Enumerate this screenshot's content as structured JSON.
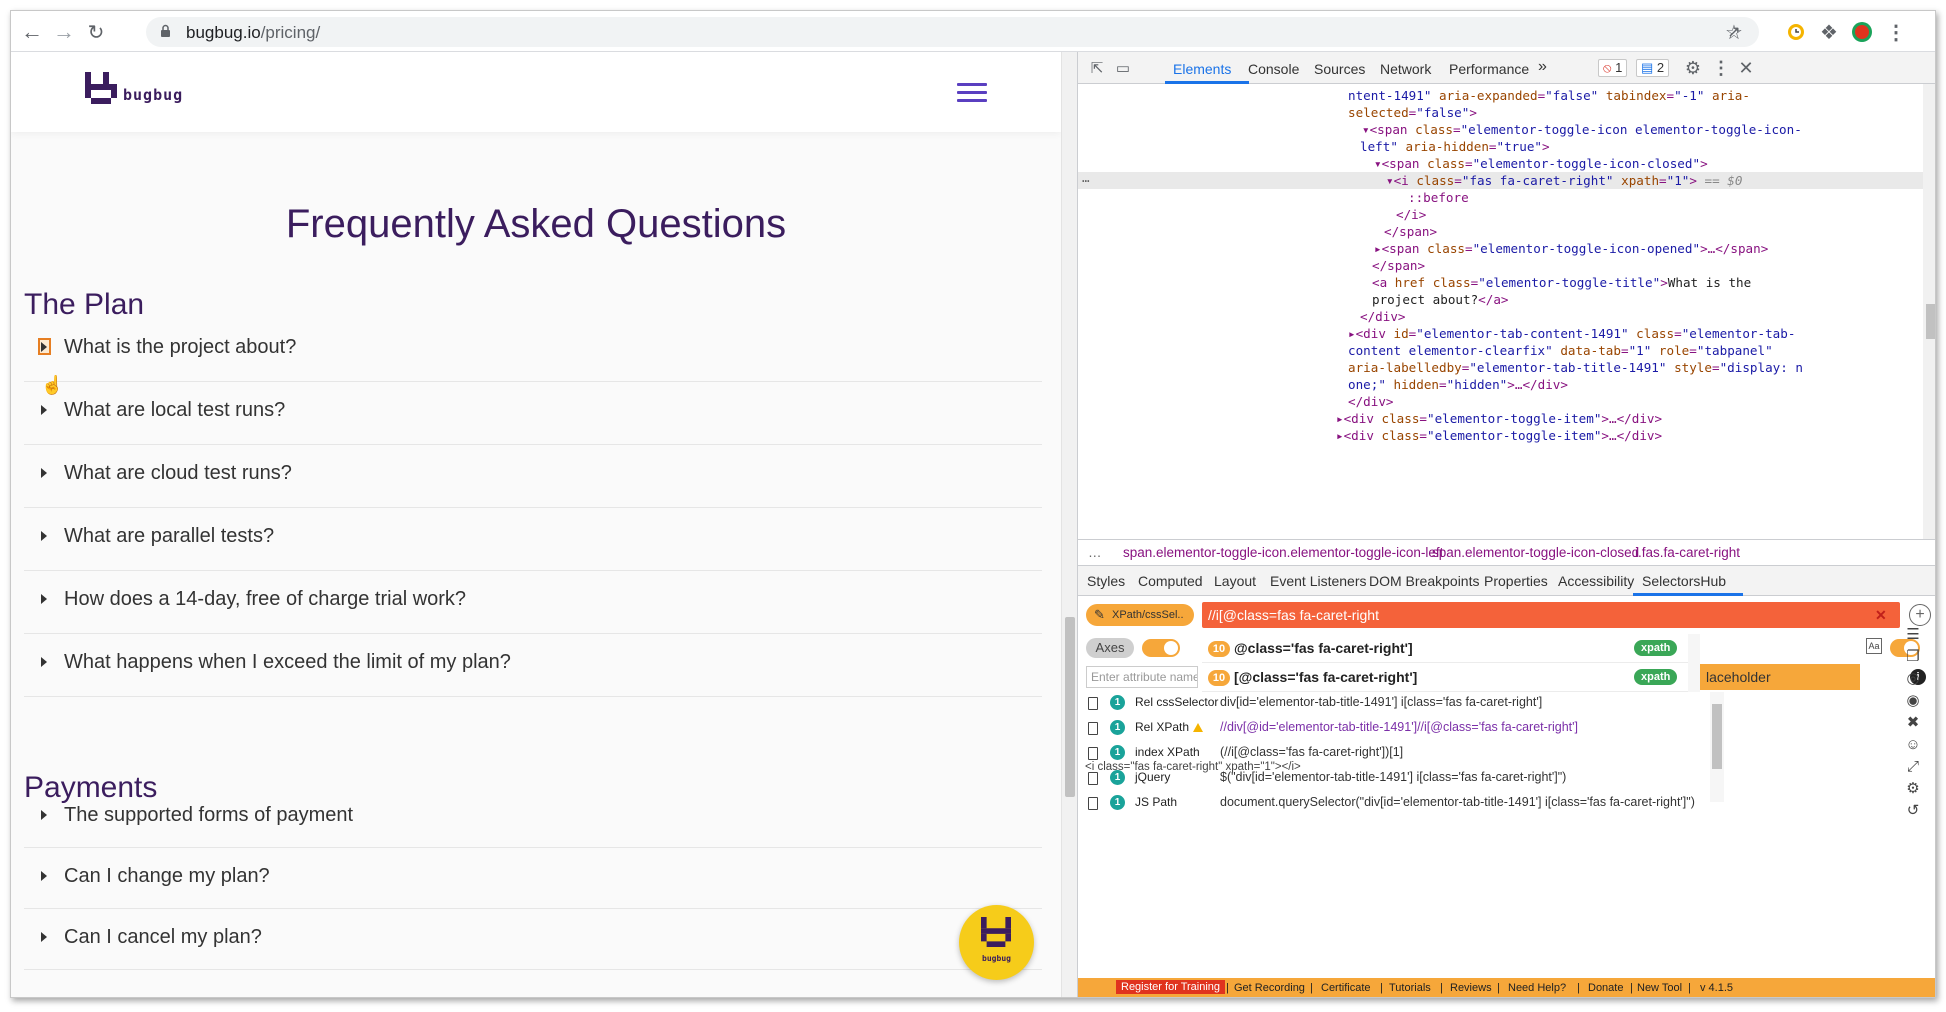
{
  "browser": {
    "url_host": "bugbug.io",
    "url_path": "/pricing/"
  },
  "site": {
    "logo_text": "bugbug",
    "faq_title": "Frequently Asked Questions",
    "section_plan": "The Plan",
    "plan_questions": [
      "What is the project about?",
      "What are local test runs?",
      "What are cloud test runs?",
      "What are parallel tests?",
      "How does a 14-day, free of charge trial work?",
      "What happens when I exceed the limit of my plan?"
    ],
    "section_payments": "Payments",
    "payment_questions": [
      "The supported forms of payment",
      "Can I change my plan?",
      "Can I cancel my plan?"
    ],
    "fab_text": "bugbug"
  },
  "devtools": {
    "tabs": [
      "Elements",
      "Console",
      "Sources",
      "Network",
      "Performance"
    ],
    "errors": "1",
    "messages": "2",
    "breadcrumbs": [
      "span.elementor-toggle-icon.elementor-toggle-icon-left",
      "span.elementor-toggle-icon-closed",
      "i.fas.fa-caret-right"
    ],
    "subtabs": [
      "Styles",
      "Computed",
      "Layout",
      "Event Listeners",
      "DOM Breakpoints",
      "Properties",
      "Accessibility",
      "SelectorsHub"
    ]
  },
  "selectorshub": {
    "mode_label": "XPath/cssSel..",
    "query": "//i[@class=fas fa-caret-right",
    "axes_label": "Axes",
    "attr_placeholder": "Enter attribute name",
    "placeholder_label": "laceholder",
    "suggestions": [
      {
        "count": "10",
        "text": "@class='fas fa-caret-right']",
        "type": "xpath"
      },
      {
        "count": "10",
        "text": "[@class='fas fa-caret-right']",
        "type": "xpath"
      }
    ],
    "results": [
      {
        "count": "1",
        "label": "Rel cssSelector",
        "value": "div[id='elementor-tab-title-1491'] i[class='fas fa-caret-right']"
      },
      {
        "count": "1",
        "label": "Rel XPath",
        "value": "//div[@id='elementor-tab-title-1491']//i[@class='fas fa-caret-right']"
      },
      {
        "count": "1",
        "label": "index XPath",
        "value": "(//i[@class='fas fa-caret-right'])[1]"
      },
      {
        "count": "1",
        "label": "jQuery",
        "value": "$(\"div[id='elementor-tab-title-1491'] i[class='fas fa-caret-right']\")"
      },
      {
        "count": "1",
        "label": "JS Path",
        "value": "document.querySelector(\"div[id='elementor-tab-title-1491'] i[class='fas fa-caret-right']\")"
      }
    ],
    "snippet": "<i class=\"fas fa-caret-right\" xpath=\"1\"></i>",
    "footer": [
      "Register for Training",
      "Get Recording",
      "Certificate",
      "Tutorials",
      "Reviews",
      "Need Help?",
      "Donate",
      "New Tool",
      "v 4.1.5"
    ]
  }
}
